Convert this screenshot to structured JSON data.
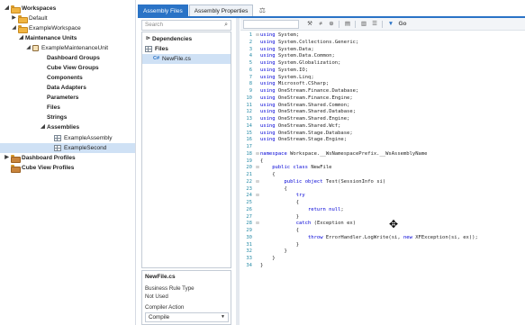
{
  "left_tree": {
    "rows": [
      {
        "label": "Workspaces",
        "bold": true,
        "arrow": "◢",
        "icon": "folder"
      },
      {
        "label": "Default",
        "bold": false,
        "arrow": "▶",
        "icon": "folder"
      },
      {
        "label": "ExampleWorkspace",
        "bold": false,
        "arrow": "◢",
        "icon": "folder"
      },
      {
        "label": "Maintenance Units",
        "bold": true,
        "arrow": "◢",
        "icon": "none"
      },
      {
        "label": "ExampleMaintenanceUnit",
        "bold": false,
        "arrow": "◢",
        "icon": "unit"
      },
      {
        "label": "Dashboard Groups",
        "bold": true,
        "arrow": "",
        "icon": "none"
      },
      {
        "label": "Cube View Groups",
        "bold": true,
        "arrow": "",
        "icon": "none"
      },
      {
        "label": "Components",
        "bold": true,
        "arrow": "",
        "icon": "none"
      },
      {
        "label": "Data Adapters",
        "bold": true,
        "arrow": "",
        "icon": "none"
      },
      {
        "label": "Parameters",
        "bold": true,
        "arrow": "",
        "icon": "none"
      },
      {
        "label": "Files",
        "bold": true,
        "arrow": "",
        "icon": "none"
      },
      {
        "label": "Strings",
        "bold": true,
        "arrow": "",
        "icon": "none"
      },
      {
        "label": "Assemblies",
        "bold": true,
        "arrow": "◢",
        "icon": "none"
      },
      {
        "label": "ExampleAssembly",
        "bold": false,
        "arrow": "",
        "icon": "grid"
      },
      {
        "label": "ExampleSecond",
        "bold": false,
        "arrow": "",
        "icon": "grid",
        "selected": true
      },
      {
        "label": "Dashboard Profiles",
        "bold": true,
        "arrow": "▶",
        "icon": "folder-brown"
      },
      {
        "label": "Cube View Profiles",
        "bold": true,
        "arrow": "",
        "icon": "folder-brown"
      }
    ]
  },
  "tabs": {
    "assembly_files": "Assembly Files",
    "assembly_properties": "Assembly Properties"
  },
  "middle": {
    "search_placeholder": "Search",
    "tree": [
      {
        "label": "Dependencies",
        "bold": true
      },
      {
        "label": "Files",
        "bold": true
      },
      {
        "label": "NewFile.cs",
        "bold": false,
        "selected": true
      }
    ],
    "properties": {
      "title": "NewFile.cs",
      "business_rule_type_label": "Business Rule Type",
      "business_rule_type_value": "Not Used",
      "compiler_action_label": "Compiler Action",
      "compiler_action_value": "Compile"
    }
  },
  "toolbar": {
    "go_label": "Go"
  },
  "code_lines": [
    {
      "n": "1",
      "fold": "⊟",
      "text": "using System;"
    },
    {
      "n": "2",
      "fold": "",
      "text": "using System.Collections.Generic;"
    },
    {
      "n": "3",
      "fold": "",
      "text": "using System.Data;"
    },
    {
      "n": "4",
      "fold": "",
      "text": "using System.Data.Common;"
    },
    {
      "n": "5",
      "fold": "",
      "text": "using System.Globalization;"
    },
    {
      "n": "6",
      "fold": "",
      "text": "using System.IO;"
    },
    {
      "n": "7",
      "fold": "",
      "text": "using System.Linq;"
    },
    {
      "n": "8",
      "fold": "",
      "text": "using Microsoft.CSharp;"
    },
    {
      "n": "9",
      "fold": "",
      "text": "using OneStream.Finance.Database;"
    },
    {
      "n": "10",
      "fold": "",
      "text": "using OneStream.Finance.Engine;"
    },
    {
      "n": "11",
      "fold": "",
      "text": "using OneStream.Shared.Common;"
    },
    {
      "n": "12",
      "fold": "",
      "text": "using OneStream.Shared.Database;"
    },
    {
      "n": "13",
      "fold": "",
      "text": "using OneStream.Shared.Engine;"
    },
    {
      "n": "14",
      "fold": "",
      "text": "using OneStream.Shared.Wcf;"
    },
    {
      "n": "15",
      "fold": "",
      "text": "using OneStream.Stage.Database;"
    },
    {
      "n": "16",
      "fold": "",
      "text": "using OneStream.Stage.Engine;"
    },
    {
      "n": "17",
      "fold": "",
      "text": ""
    },
    {
      "n": "18",
      "fold": "⊟",
      "text": "namespace Workspace.__WsNamespacePrefix.__WsAssemblyName"
    },
    {
      "n": "19",
      "fold": "",
      "text": "{"
    },
    {
      "n": "20",
      "fold": "⊟",
      "text": "    public class NewFile"
    },
    {
      "n": "21",
      "fold": "",
      "text": "    {"
    },
    {
      "n": "22",
      "fold": "⊟",
      "text": "        public object Test(SessionInfo si)"
    },
    {
      "n": "23",
      "fold": "",
      "text": "        {"
    },
    {
      "n": "24",
      "fold": "⊟",
      "text": "            try"
    },
    {
      "n": "25",
      "fold": "",
      "text": "            {"
    },
    {
      "n": "26",
      "fold": "",
      "text": "                return null;"
    },
    {
      "n": "27",
      "fold": "",
      "text": "            }"
    },
    {
      "n": "28",
      "fold": "⊟",
      "text": "            catch (Exception ex)"
    },
    {
      "n": "29",
      "fold": "",
      "text": "            {"
    },
    {
      "n": "30",
      "fold": "",
      "text": "                throw ErrorHandler.LogWrite(si, new XFException(si, ex));"
    },
    {
      "n": "31",
      "fold": "",
      "text": "            }"
    },
    {
      "n": "32",
      "fold": "",
      "text": "        }"
    },
    {
      "n": "33",
      "fold": "",
      "text": "    }"
    },
    {
      "n": "34",
      "fold": "",
      "text": "}"
    }
  ]
}
